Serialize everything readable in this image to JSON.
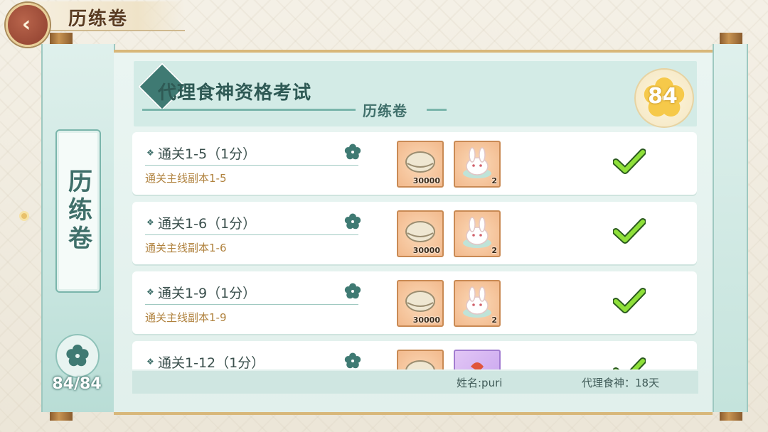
{
  "header": {
    "back_icon": "chevron-left-icon",
    "page_title": "历练卷"
  },
  "left_scroll": {
    "label": "历练卷",
    "emblem_icon": "flower-icon",
    "count": "84/84"
  },
  "panel": {
    "title": "代理食神资格考试",
    "subtitle": "历练卷",
    "score": "84",
    "tasks": [
      {
        "title": "通关1-5（1分）",
        "desc": "通关主线副本1-5",
        "rewards": [
          {
            "icon": "shell-coin-icon",
            "count": "30000"
          },
          {
            "icon": "rabbit-dumpling-icon",
            "count": "2"
          }
        ],
        "completed": true
      },
      {
        "title": "通关1-6（1分）",
        "desc": "通关主线副本1-6",
        "rewards": [
          {
            "icon": "shell-coin-icon",
            "count": "30000"
          },
          {
            "icon": "rabbit-dumpling-icon",
            "count": "2"
          }
        ],
        "completed": true
      },
      {
        "title": "通关1-9（1分）",
        "desc": "通关主线副本1-9",
        "rewards": [
          {
            "icon": "shell-coin-icon",
            "count": "30000"
          },
          {
            "icon": "rabbit-dumpling-icon",
            "count": "2"
          }
        ],
        "completed": true
      },
      {
        "title": "通关1-12（1分）",
        "desc": "",
        "rewards": [
          {
            "icon": "shell-coin-icon",
            "count": ""
          },
          {
            "icon": "purple-card-icon",
            "count": ""
          }
        ],
        "completed": true
      }
    ]
  },
  "footer": {
    "name": "姓名:puri",
    "days": "代理食神：18天"
  },
  "colors": {
    "accent_teal": "#3f7a73",
    "desc_gold": "#b0823e",
    "check_green": "#7ccf2a"
  }
}
